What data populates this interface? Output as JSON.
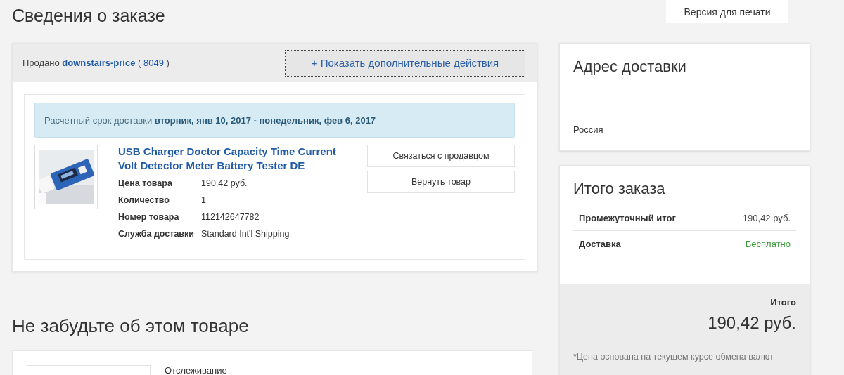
{
  "page": {
    "title": "Сведения о заказе",
    "print_button": "Версия для печати"
  },
  "order": {
    "sold_by_label": "Продано",
    "seller": "downstairs-price",
    "feedback_open": "(",
    "feedback": "8049",
    "feedback_close": ")",
    "more_actions": "+ Показать дополнительные действия",
    "delivery": "Расчетный срок доставки **вторник, янв 10, 2017 - понедельник, фев 6, 2017**",
    "item": {
      "title": "USB Charger Doctor Capacity Time Current Volt Detector Meter Battery Tester DE",
      "details": [
        {
          "label": "Цена товара",
          "value": "190,42 руб."
        },
        {
          "label": "Количество",
          "value": "1"
        },
        {
          "label": "Номер товара",
          "value": "112142647782"
        },
        {
          "label": "Служба доставки",
          "value": "Standard Int'l Shipping"
        }
      ]
    },
    "actions": [
      "Связаться с продавцом",
      "Вернуть товар"
    ]
  },
  "address": {
    "title": "Адрес доставки",
    "country": "Россия"
  },
  "summary": {
    "title": "Итого заказа",
    "lines": [
      {
        "label": "Промежуточный итог",
        "value": "190,42 руб.",
        "kind": "amount"
      },
      {
        "label": "Доставка",
        "value": "Бесплатно",
        "kind": "free"
      }
    ],
    "total_label": "Итого",
    "total": "190,42 руб.",
    "note": "*Цена основана на текущем курсе обмена валют"
  },
  "reminder": {
    "title": "Не забудьте об этом товаре",
    "label": "Отслеживание"
  }
}
